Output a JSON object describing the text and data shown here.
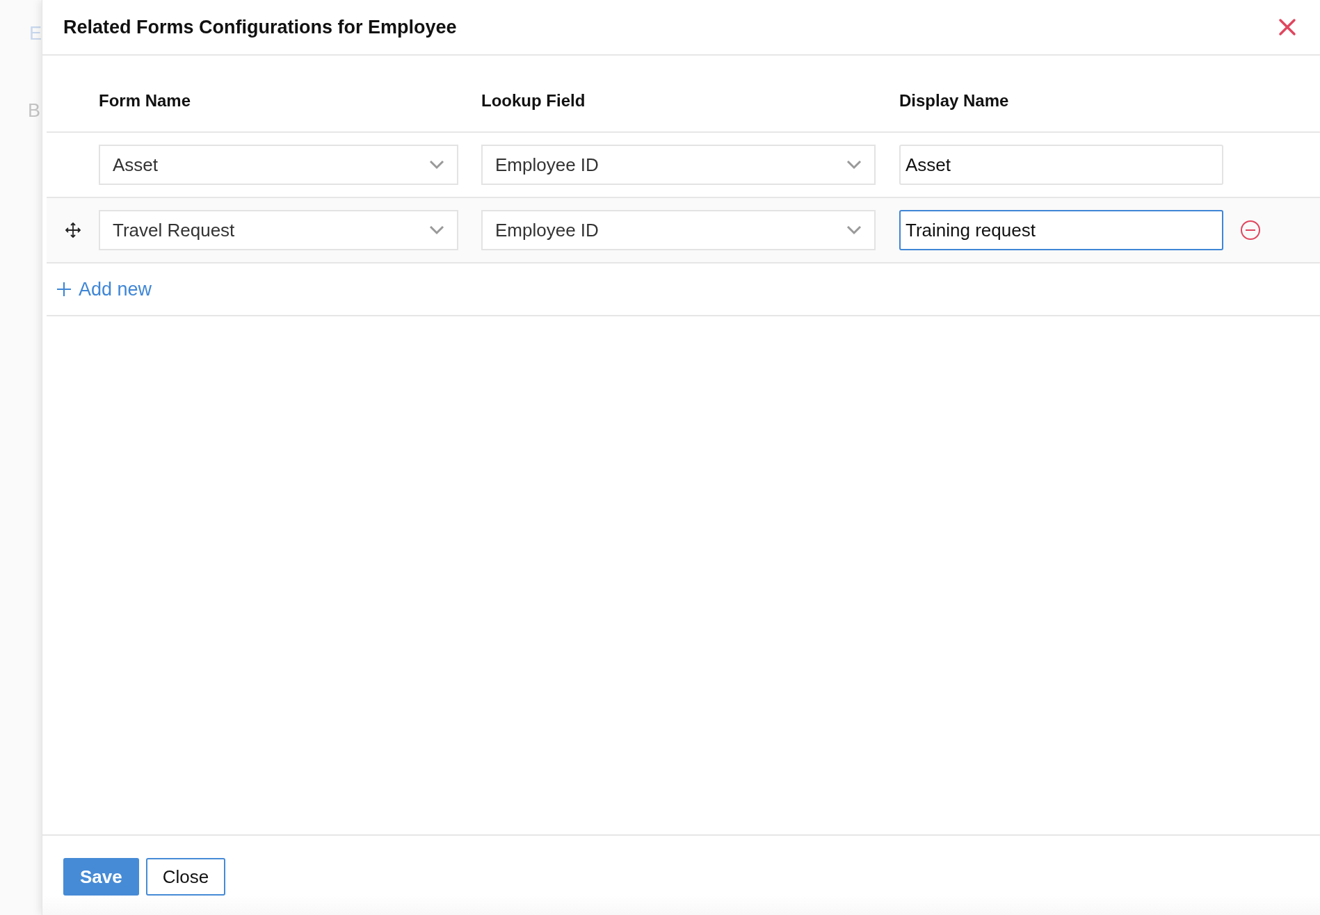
{
  "background": {
    "letters": [
      "E",
      "B"
    ]
  },
  "dialog": {
    "title": "Related Forms Configurations for Employee"
  },
  "table": {
    "columns": [
      "Form Name",
      "Lookup Field",
      "Display Name"
    ],
    "rows": [
      {
        "form_name": "Asset",
        "lookup_field": "Employee ID",
        "display_name": "Asset",
        "draggable": false,
        "removable": false,
        "focused": false
      },
      {
        "form_name": "Travel Request",
        "lookup_field": "Employee ID",
        "display_name": "Training request",
        "draggable": true,
        "removable": true,
        "focused": true
      }
    ]
  },
  "add_link": "Add new",
  "buttons": [
    {
      "label": "Save",
      "kind": "primary"
    },
    {
      "label": "Close",
      "kind": "secondary"
    }
  ]
}
